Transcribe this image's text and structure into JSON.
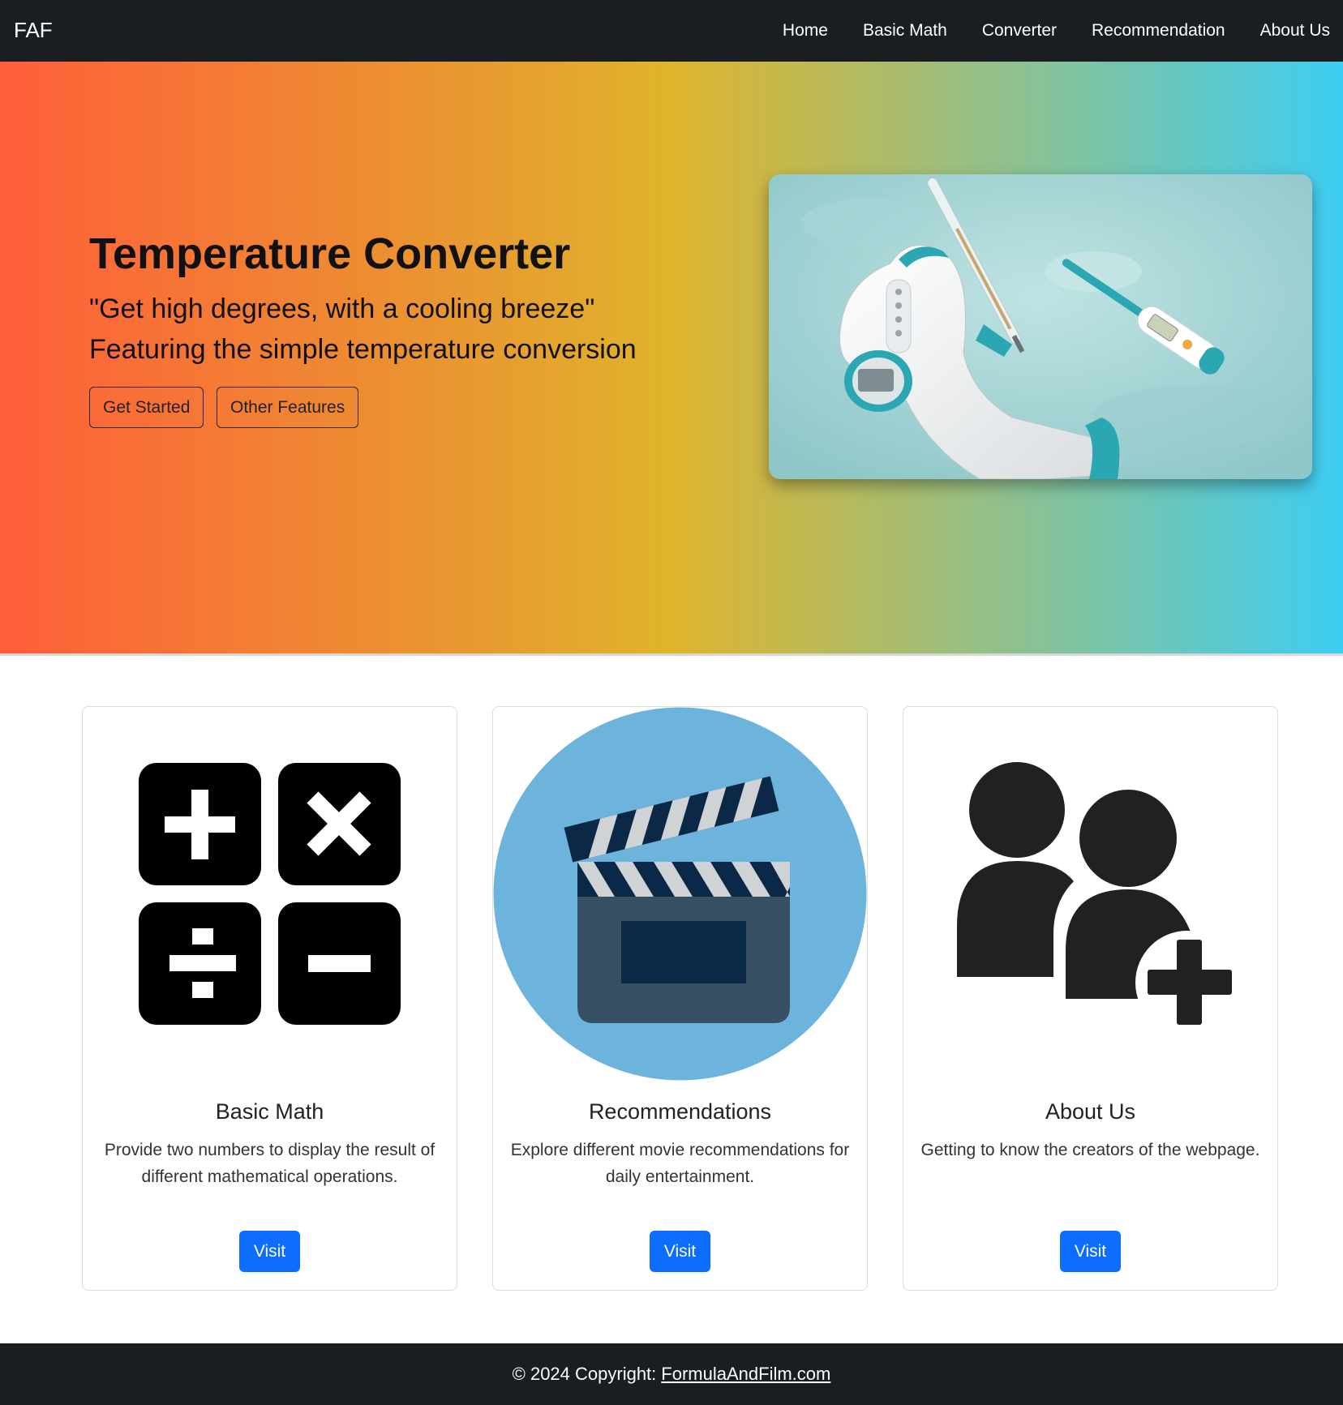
{
  "navbar": {
    "brand": "FAF",
    "links": [
      {
        "label": "Home"
      },
      {
        "label": "Basic Math"
      },
      {
        "label": "Converter"
      },
      {
        "label": "Recommendation"
      },
      {
        "label": "About Us"
      }
    ]
  },
  "hero": {
    "title": "Temperature Converter",
    "quote": "\"Get high degrees, with a cooling breeze\"",
    "subtitle": "Featuring the simple temperature conversion",
    "buttons": {
      "get_started": "Get Started",
      "other_features": "Other Features"
    },
    "gradient_colors": [
      "#ff5e3a",
      "#e0b42c",
      "#3ecdf4"
    ]
  },
  "cards": [
    {
      "icon": "math-operations-icon",
      "title": "Basic Math",
      "text": "Provide two numbers to display the result of different mathematical operations.",
      "button": "Visit"
    },
    {
      "icon": "clapperboard-icon",
      "title": "Recommendations",
      "text": "Explore different movie recommendations for daily entertainment.",
      "button": "Visit"
    },
    {
      "icon": "add-user-icon",
      "title": "About Us",
      "text": "Getting to know the creators of the webpage.",
      "button": "Visit"
    }
  ],
  "footer": {
    "copyright": "© 2024 Copyright:",
    "link": "FormulaAndFilm.com"
  },
  "colors": {
    "navbar_bg": "#1b1e21",
    "primary_button": "#0d6efd",
    "clapper_circle": "#6cb4dc"
  }
}
